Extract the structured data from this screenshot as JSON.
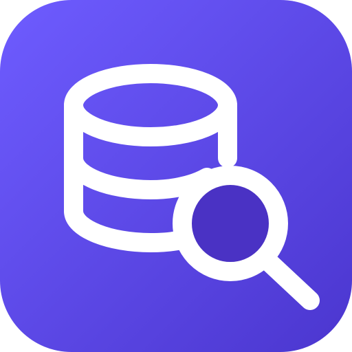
{
  "icon": {
    "name": "database-search-icon",
    "background_gradient_start": "#6E5CFF",
    "background_gradient_end": "#4B36CF",
    "stroke_color": "#FFFFFF",
    "lens_fill_color": "#4A32C4"
  }
}
